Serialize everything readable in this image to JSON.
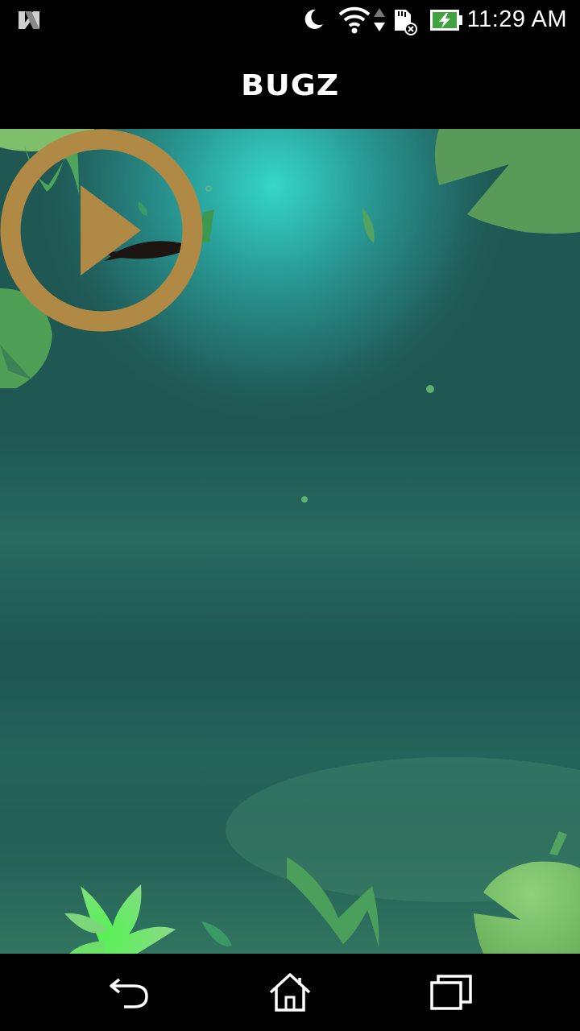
{
  "status_bar": {
    "time": "11:29 AM",
    "icons": [
      "n-notification-icon",
      "moon-icon",
      "wifi-icon",
      "data-arrows-icon",
      "sd-card-icon",
      "battery-charging-icon"
    ]
  },
  "app_bar": {
    "title": "BUGZ"
  },
  "game": {
    "play_icon": "play-circle-icon",
    "play_color": "#b08a45"
  },
  "nav_bar": {
    "buttons": [
      "back-icon",
      "home-icon",
      "recents-icon"
    ]
  },
  "colors": {
    "water_dark": "#1e5250",
    "water_glow": "#35d6c8",
    "lily_pad": "#5a9a58",
    "accent_green": "#5ad85a"
  }
}
